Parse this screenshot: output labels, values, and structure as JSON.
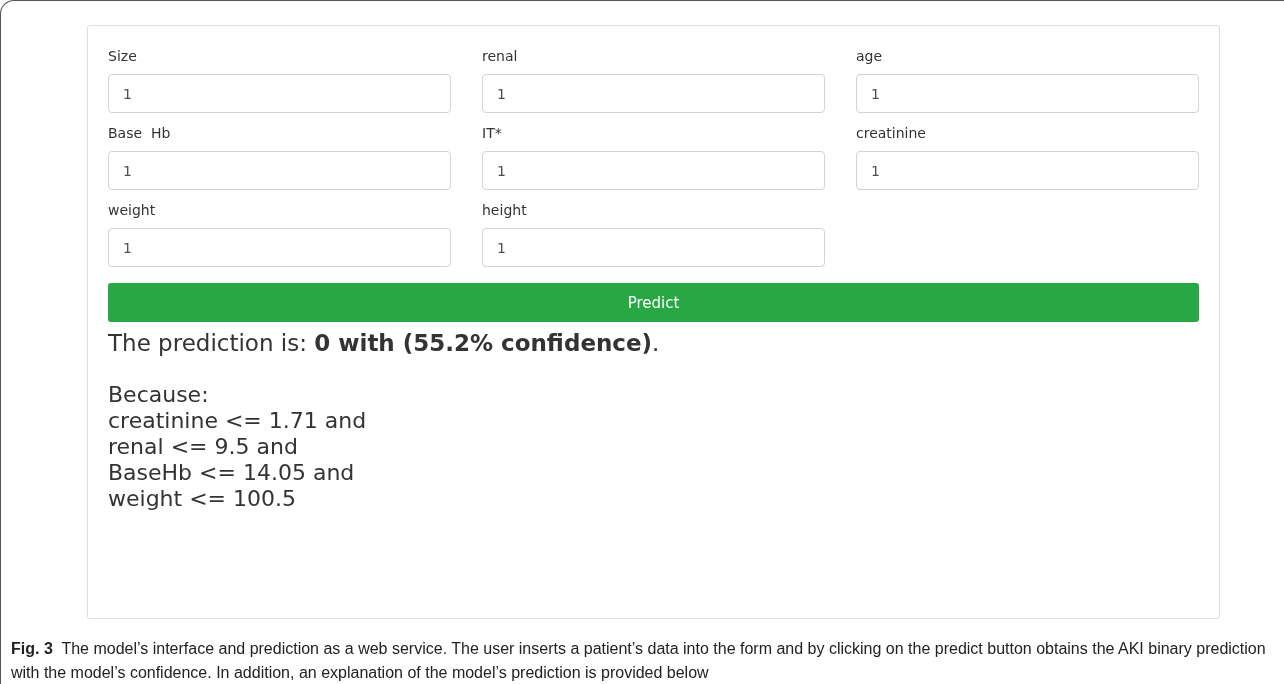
{
  "form": {
    "fields": [
      {
        "label": "Size",
        "value": "1"
      },
      {
        "label": "renal",
        "value": "1"
      },
      {
        "label": "age",
        "value": "1"
      },
      {
        "label": "Base  Hb",
        "value": "1"
      },
      {
        "label": "IT*",
        "value": "1"
      },
      {
        "label": "creatinine",
        "value": "1"
      },
      {
        "label": "weight",
        "value": "1"
      },
      {
        "label": "height",
        "value": "1"
      }
    ],
    "submit_button": "Predict"
  },
  "result": {
    "prediction": "The prediction is: **0 with (55.2% confidence)**.",
    "explanation_lines": [
      "Because:",
      "creatinine <= 1.71 and",
      "renal <= 9.5 and",
      "BaseHb <= 14.05 and",
      "weight <= 100.5"
    ]
  },
  "caption": {
    "label": "Fig. 3",
    "text": "The model’s interface and prediction as a web service. The user inserts a patient’s data into the form and by clicking on the predict button obtains the AKI binary prediction with the model’s confidence. In addition, an explanation of the model’s prediction is provided below"
  }
}
